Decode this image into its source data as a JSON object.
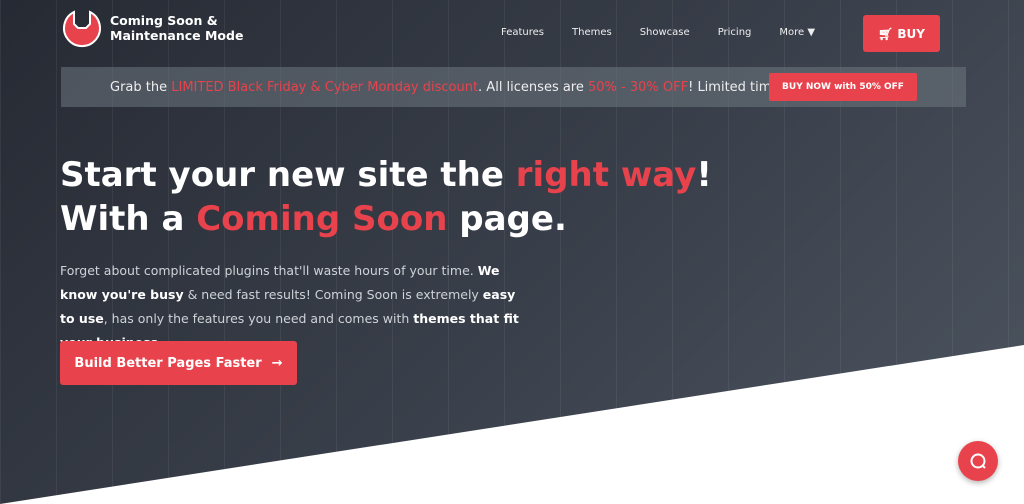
{
  "brand": {
    "line1": "Coming Soon &",
    "line2": "Maintenance Mode",
    "accent": "#e8434d"
  },
  "nav": {
    "items": [
      "Features",
      "Themes",
      "Showcase",
      "Pricing",
      "More ▼"
    ],
    "buy_label": "BUY"
  },
  "promo": {
    "t1": "Grab the ",
    "t2": "LIMITED Black Friday & Cyber Monday discount",
    "t3": ". All licenses are ",
    "t4": "50% - 30% OFF",
    "t5": "! Limited time only.",
    "button": "BUY NOW with 50% OFF"
  },
  "hero": {
    "h1a": "Start your new site the ",
    "h1b": "right way",
    "h1c": "!",
    "h2a": "With a ",
    "h2b": "Coming Soon",
    "h2c": " page.",
    "d1": "Forget about complicated plugins that'll waste hours of your time. ",
    "d2": "We know you're busy",
    "d3": " & need fast results! Coming Soon is extremely ",
    "d4": "easy to use",
    "d5": ", has only the features you need and comes with ",
    "d6": "themes that fit your business",
    "d7": ".",
    "cta": "Build Better Pages Faster"
  }
}
